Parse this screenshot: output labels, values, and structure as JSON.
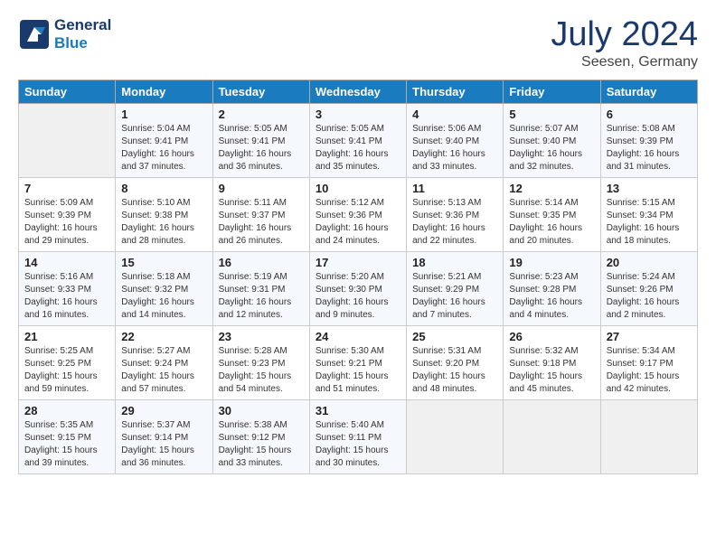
{
  "header": {
    "logo_line1": "General",
    "logo_line2": "Blue",
    "month": "July 2024",
    "location": "Seesen, Germany"
  },
  "columns": [
    "Sunday",
    "Monday",
    "Tuesday",
    "Wednesday",
    "Thursday",
    "Friday",
    "Saturday"
  ],
  "weeks": [
    [
      {
        "day": "",
        "content": ""
      },
      {
        "day": "1",
        "content": "Sunrise: 5:04 AM\nSunset: 9:41 PM\nDaylight: 16 hours\nand 37 minutes."
      },
      {
        "day": "2",
        "content": "Sunrise: 5:05 AM\nSunset: 9:41 PM\nDaylight: 16 hours\nand 36 minutes."
      },
      {
        "day": "3",
        "content": "Sunrise: 5:05 AM\nSunset: 9:41 PM\nDaylight: 16 hours\nand 35 minutes."
      },
      {
        "day": "4",
        "content": "Sunrise: 5:06 AM\nSunset: 9:40 PM\nDaylight: 16 hours\nand 33 minutes."
      },
      {
        "day": "5",
        "content": "Sunrise: 5:07 AM\nSunset: 9:40 PM\nDaylight: 16 hours\nand 32 minutes."
      },
      {
        "day": "6",
        "content": "Sunrise: 5:08 AM\nSunset: 9:39 PM\nDaylight: 16 hours\nand 31 minutes."
      }
    ],
    [
      {
        "day": "7",
        "content": "Sunrise: 5:09 AM\nSunset: 9:39 PM\nDaylight: 16 hours\nand 29 minutes."
      },
      {
        "day": "8",
        "content": "Sunrise: 5:10 AM\nSunset: 9:38 PM\nDaylight: 16 hours\nand 28 minutes."
      },
      {
        "day": "9",
        "content": "Sunrise: 5:11 AM\nSunset: 9:37 PM\nDaylight: 16 hours\nand 26 minutes."
      },
      {
        "day": "10",
        "content": "Sunrise: 5:12 AM\nSunset: 9:36 PM\nDaylight: 16 hours\nand 24 minutes."
      },
      {
        "day": "11",
        "content": "Sunrise: 5:13 AM\nSunset: 9:36 PM\nDaylight: 16 hours\nand 22 minutes."
      },
      {
        "day": "12",
        "content": "Sunrise: 5:14 AM\nSunset: 9:35 PM\nDaylight: 16 hours\nand 20 minutes."
      },
      {
        "day": "13",
        "content": "Sunrise: 5:15 AM\nSunset: 9:34 PM\nDaylight: 16 hours\nand 18 minutes."
      }
    ],
    [
      {
        "day": "14",
        "content": "Sunrise: 5:16 AM\nSunset: 9:33 PM\nDaylight: 16 hours\nand 16 minutes."
      },
      {
        "day": "15",
        "content": "Sunrise: 5:18 AM\nSunset: 9:32 PM\nDaylight: 16 hours\nand 14 minutes."
      },
      {
        "day": "16",
        "content": "Sunrise: 5:19 AM\nSunset: 9:31 PM\nDaylight: 16 hours\nand 12 minutes."
      },
      {
        "day": "17",
        "content": "Sunrise: 5:20 AM\nSunset: 9:30 PM\nDaylight: 16 hours\nand 9 minutes."
      },
      {
        "day": "18",
        "content": "Sunrise: 5:21 AM\nSunset: 9:29 PM\nDaylight: 16 hours\nand 7 minutes."
      },
      {
        "day": "19",
        "content": "Sunrise: 5:23 AM\nSunset: 9:28 PM\nDaylight: 16 hours\nand 4 minutes."
      },
      {
        "day": "20",
        "content": "Sunrise: 5:24 AM\nSunset: 9:26 PM\nDaylight: 16 hours\nand 2 minutes."
      }
    ],
    [
      {
        "day": "21",
        "content": "Sunrise: 5:25 AM\nSunset: 9:25 PM\nDaylight: 15 hours\nand 59 minutes."
      },
      {
        "day": "22",
        "content": "Sunrise: 5:27 AM\nSunset: 9:24 PM\nDaylight: 15 hours\nand 57 minutes."
      },
      {
        "day": "23",
        "content": "Sunrise: 5:28 AM\nSunset: 9:23 PM\nDaylight: 15 hours\nand 54 minutes."
      },
      {
        "day": "24",
        "content": "Sunrise: 5:30 AM\nSunset: 9:21 PM\nDaylight: 15 hours\nand 51 minutes."
      },
      {
        "day": "25",
        "content": "Sunrise: 5:31 AM\nSunset: 9:20 PM\nDaylight: 15 hours\nand 48 minutes."
      },
      {
        "day": "26",
        "content": "Sunrise: 5:32 AM\nSunset: 9:18 PM\nDaylight: 15 hours\nand 45 minutes."
      },
      {
        "day": "27",
        "content": "Sunrise: 5:34 AM\nSunset: 9:17 PM\nDaylight: 15 hours\nand 42 minutes."
      }
    ],
    [
      {
        "day": "28",
        "content": "Sunrise: 5:35 AM\nSunset: 9:15 PM\nDaylight: 15 hours\nand 39 minutes."
      },
      {
        "day": "29",
        "content": "Sunrise: 5:37 AM\nSunset: 9:14 PM\nDaylight: 15 hours\nand 36 minutes."
      },
      {
        "day": "30",
        "content": "Sunrise: 5:38 AM\nSunset: 9:12 PM\nDaylight: 15 hours\nand 33 minutes."
      },
      {
        "day": "31",
        "content": "Sunrise: 5:40 AM\nSunset: 9:11 PM\nDaylight: 15 hours\nand 30 minutes."
      },
      {
        "day": "",
        "content": ""
      },
      {
        "day": "",
        "content": ""
      },
      {
        "day": "",
        "content": ""
      }
    ]
  ]
}
